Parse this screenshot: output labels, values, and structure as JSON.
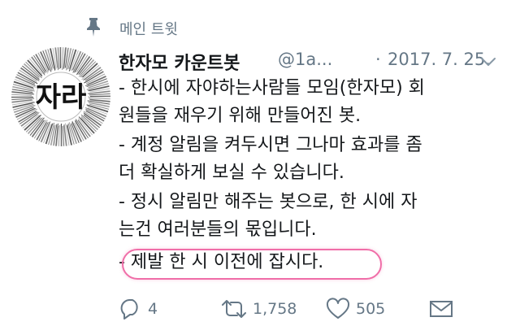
{
  "pinned": {
    "label": "메인 트윗",
    "icon": "pin-icon"
  },
  "tweet": {
    "display_name": "한자모 카운트봇",
    "handle": "@1a...",
    "separator": "·",
    "date": "2017. 7. 25.",
    "avatar_text": "자라",
    "lines": [
      "- 한시에 자야하는사람들 모임(한자모) 회",
      "원들을 재우기 위해 만들어진 봇.",
      "- 계정 알림을 켜두시면 그나마 효과를 좀",
      "더 확실하게 보실 수 있습니다.",
      "- 정시 알림만 해주는 봇으로, 한 시에 자",
      "는건 여러분들의 몫입니다.",
      "- 제발 한 시 이전에 잡시다."
    ]
  },
  "actions": {
    "reply": {
      "icon": "reply-icon",
      "count": "4"
    },
    "retweet": {
      "icon": "retweet-icon",
      "count": "1,758"
    },
    "like": {
      "icon": "heart-icon",
      "count": "505"
    },
    "message": {
      "icon": "envelope-icon"
    }
  },
  "colors": {
    "muted": "#657786",
    "text": "#14171a",
    "highlight": "#f06ea8"
  }
}
